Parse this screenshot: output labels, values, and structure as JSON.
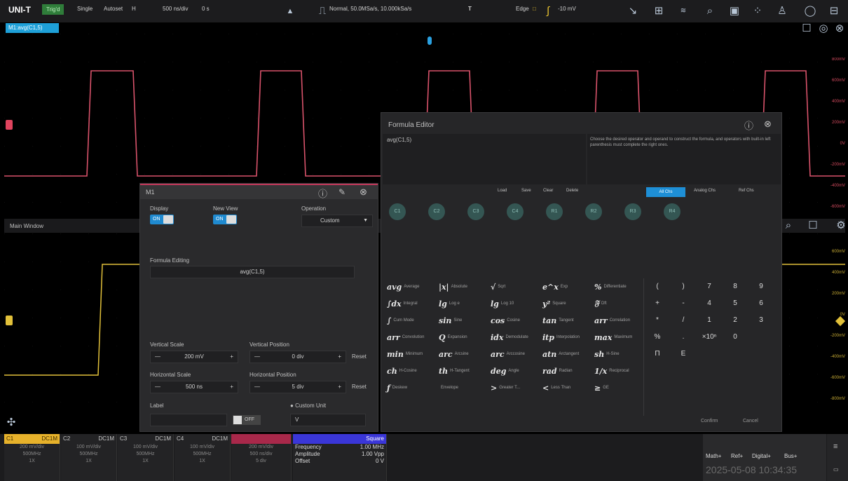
{
  "topbar": {
    "logo": "UNI-T",
    "trig_state": "Trig'd",
    "single": "Single",
    "autoset": "Autoset",
    "h": "H",
    "timebase": "500 ns/div",
    "delay": "0 s",
    "acq": "Normal, 50.0MSa/s, 10.000kSa/s",
    "trig_btn": "T",
    "trig_type": "Edge",
    "trig_level": "-10 mV"
  },
  "math_tab": "M1:avg(C1,5)",
  "lower_title": "Main Window",
  "m1": {
    "title": "M1",
    "display_label": "Display",
    "display_on": "ON",
    "newview_label": "New View",
    "newview_on": "ON",
    "operation_label": "Operation",
    "operation_value": "Custom",
    "formula_label": "Formula Editing",
    "formula_value": "avg(C1,5)",
    "vscale_label": "Vertical Scale",
    "vscale_value": "200 mV",
    "vpos_label": "Vertical Position",
    "vpos_value": "0 div",
    "hscale_label": "Horizontal Scale",
    "hscale_value": "500 ns",
    "hpos_label": "Horizontal Position",
    "hpos_value": "5 div",
    "reset1": "Reset",
    "reset2": "Reset",
    "label_label": "Label",
    "label_off": "OFF",
    "custom_unit_label": "Custom Unit",
    "custom_unit_value": "V"
  },
  "fe": {
    "title": "Formula Editor",
    "formula": "avg(C1,5)",
    "hint": "Choose the desired operator and operand to construct the formula, and operators with built-in left parenthesis must complete the right ones.",
    "load": "Load",
    "save": "Save",
    "clear": "Clear",
    "delete": "Delete",
    "tab_all": "All Chs",
    "tab_analog": "Analog Chs",
    "tab_ref": "Ref Chs",
    "channels": [
      "C1",
      "C2",
      "C3",
      "C4",
      "R1",
      "R2",
      "R3",
      "R4"
    ],
    "confirm": "Confirm",
    "cancel": "Cancel",
    "ops": [
      {
        "sym": "avg",
        "name": "Average"
      },
      {
        "sym": "|x|",
        "name": "Absolute"
      },
      {
        "sym": "√",
        "name": "Sqrt"
      },
      {
        "sym": "e^x",
        "name": "Exp"
      },
      {
        "sym": "%",
        "name": "Differentiate"
      },
      {
        "sym": "∫dx",
        "name": "Integral"
      },
      {
        "sym": "lg",
        "name": "Log e"
      },
      {
        "sym": "lg",
        "name": "Log 10"
      },
      {
        "sym": "y²",
        "name": "Square"
      },
      {
        "sym": "𝔉",
        "name": "Dft"
      },
      {
        "sym": "∫",
        "name": "Cum Mode"
      },
      {
        "sym": "sin",
        "name": "Sine"
      },
      {
        "sym": "cos",
        "name": "Cosine"
      },
      {
        "sym": "tan",
        "name": "Tangent"
      },
      {
        "sym": "arr",
        "name": "Correlation"
      },
      {
        "sym": "arr",
        "name": "Convolution"
      },
      {
        "sym": "Q",
        "name": "Expansion"
      },
      {
        "sym": "idx",
        "name": "Demodulate"
      },
      {
        "sym": "itp",
        "name": "Interpolation"
      },
      {
        "sym": "max",
        "name": "Maximum"
      },
      {
        "sym": "min",
        "name": "Minimum"
      },
      {
        "sym": "arc",
        "name": "Arcsine"
      },
      {
        "sym": "arc",
        "name": "Arccosine"
      },
      {
        "sym": "atn",
        "name": "Arctangent"
      },
      {
        "sym": "sh",
        "name": "H-Sine"
      },
      {
        "sym": "ch",
        "name": "H-Cosine"
      },
      {
        "sym": "th",
        "name": "H-Tangent"
      },
      {
        "sym": "deg",
        "name": "Angle"
      },
      {
        "sym": "rad",
        "name": "Radian"
      },
      {
        "sym": "1/x",
        "name": "Reciprocal"
      },
      {
        "sym": "ƒ",
        "name": "Deskew"
      },
      {
        "sym": "",
        "name": "Envelope"
      },
      {
        "sym": ">",
        "name": "Greater T..."
      },
      {
        "sym": "<",
        "name": "Less Than"
      },
      {
        "sym": "≥",
        "name": "GE"
      }
    ],
    "keys": [
      "(",
      ")",
      "7",
      "8",
      "9",
      "+",
      "-",
      "4",
      "5",
      "6",
      "*",
      "/",
      "1",
      "2",
      "3",
      "%",
      ".",
      "×10ⁿ",
      "0",
      "",
      "Π",
      "E"
    ]
  },
  "right_ticks": [
    "800mV",
    "600mV",
    "400mV",
    "200mV",
    "0V",
    "-200mV",
    "-400mV",
    "-600mV"
  ],
  "right_ticks2": [
    "600mV",
    "400mV",
    "200mV",
    "0V",
    "-200mV",
    "-400mV",
    "-600mV",
    "-800mV"
  ],
  "bottom": {
    "c1": {
      "name": "C1",
      "coupling": "DC1M",
      "l1": "200 mV/div",
      "l2": "500MHz",
      "l3": "1X"
    },
    "c2": {
      "name": "C2",
      "coupling": "DC1M",
      "l1": "100 mV/div",
      "l2": "500MHz",
      "l3": "1X"
    },
    "c3": {
      "name": "C3",
      "coupling": "DC1M",
      "l1": "100 mV/div",
      "l2": "500MHz",
      "l3": "1X"
    },
    "c4": {
      "name": "C4",
      "coupling": "DC1M",
      "l1": "100 mV/div",
      "l2": "500MHz",
      "l3": "1X"
    },
    "m1": {
      "l1": "200 mV/div",
      "l2": "500 ns/div",
      "l3": "5 div"
    },
    "gen": {
      "type": "Square",
      "freq_label": "Frequency",
      "freq": "1.00 MHz",
      "amp_label": "Amplitude",
      "amp": "1.00 Vpp",
      "off_label": "Offset",
      "off": "0 V"
    },
    "math": "Math+",
    "ref": "Ref+",
    "digital": "Digital+",
    "bus": "Bus+",
    "datetime": "2025-05-08 10:34:35"
  }
}
